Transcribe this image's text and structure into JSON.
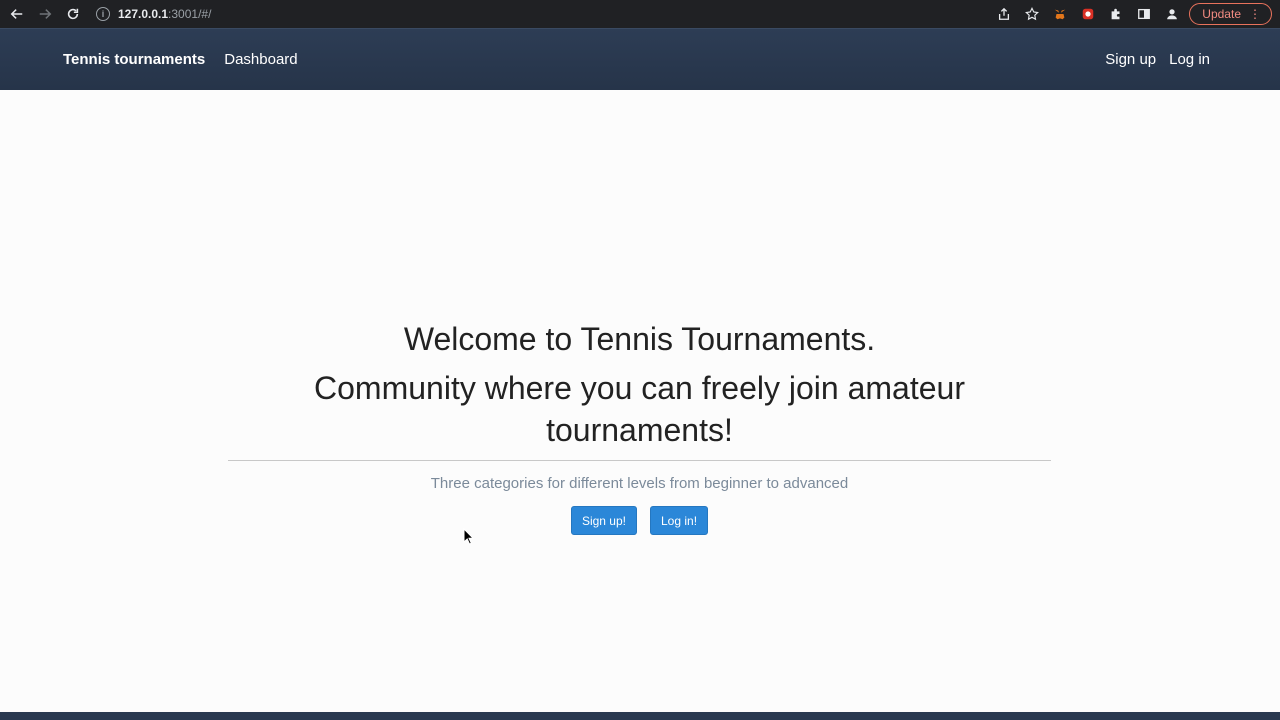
{
  "browser": {
    "url_host": "127.0.0.1",
    "url_rest": ":3001/#/",
    "update_label": "Update",
    "icons": [
      "back-icon",
      "forward-icon",
      "reload-icon",
      "info-icon",
      "share-icon",
      "star-icon",
      "metamask-icon",
      "extension-red-icon",
      "puzzle-icon",
      "sidebar-icon",
      "profile-icon",
      "menu-dots-icon"
    ]
  },
  "navbar": {
    "brand": "Tennis tournaments",
    "dashboard": "Dashboard",
    "signup": "Sign up",
    "login": "Log in"
  },
  "hero": {
    "title": "Welcome to Tennis Tournaments.",
    "subtitle": "Community where you can freely join amateur tournaments!",
    "description": "Three categories for different levels from beginner to advanced",
    "signup_button": "Sign up!",
    "login_button": "Log in!"
  },
  "colors": {
    "navbar_bg": "#2a3950",
    "button_bg": "#2b87d8",
    "update_accent": "#f28b82"
  }
}
